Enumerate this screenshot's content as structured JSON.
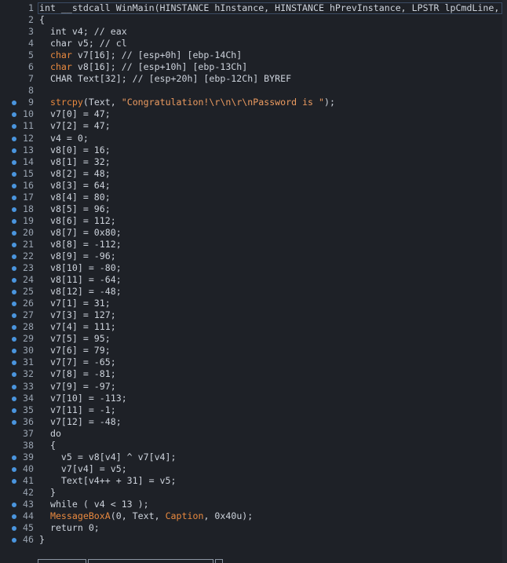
{
  "colors": {
    "background": "#1e2127",
    "text": "#cdd3dc",
    "line_number": "#9aa4b1",
    "breakpoint": "#4a95de",
    "function": "#e8893f",
    "string": "#ec9b60"
  },
  "lines": [
    {
      "num": "1",
      "bp": false,
      "tokens": [
        {
          "t": "int __stdcall WinMain(HINSTANCE hInstance, HINSTANCE hPrevInstance, LPSTR lpCmdLine,",
          "c": "plain"
        }
      ]
    },
    {
      "num": "2",
      "bp": false,
      "tokens": [
        {
          "t": "{",
          "c": "plain"
        }
      ]
    },
    {
      "num": "3",
      "bp": false,
      "tokens": [
        {
          "t": "  int v4; // eax",
          "c": "plain"
        }
      ]
    },
    {
      "num": "4",
      "bp": false,
      "tokens": [
        {
          "t": "  char v5; // cl",
          "c": "plain"
        }
      ]
    },
    {
      "num": "5",
      "bp": false,
      "tokens": [
        {
          "t": "  ",
          "c": "plain"
        },
        {
          "t": "char",
          "c": "red"
        },
        {
          "t": " v7[16]; // [esp+0h] [ebp-14Ch]",
          "c": "plain"
        }
      ]
    },
    {
      "num": "6",
      "bp": false,
      "tokens": [
        {
          "t": "  ",
          "c": "plain"
        },
        {
          "t": "char",
          "c": "red"
        },
        {
          "t": " v8[16]; // [esp+10h] [ebp-13Ch]",
          "c": "plain"
        }
      ]
    },
    {
      "num": "7",
      "bp": false,
      "tokens": [
        {
          "t": "  CHAR Text[32]; // [esp+20h] [ebp-12Ch] BYREF",
          "c": "plain"
        }
      ]
    },
    {
      "num": "8",
      "bp": false,
      "tokens": [
        {
          "t": "",
          "c": "plain"
        }
      ]
    },
    {
      "num": "9",
      "bp": true,
      "tokens": [
        {
          "t": "  ",
          "c": "plain"
        },
        {
          "t": "strcpy",
          "c": "fn"
        },
        {
          "t": "(Text, ",
          "c": "plain"
        },
        {
          "t": "\"Congratulation!\\r\\n\\r\\nPassword is \"",
          "c": "str"
        },
        {
          "t": ");",
          "c": "plain"
        }
      ]
    },
    {
      "num": "10",
      "bp": true,
      "tokens": [
        {
          "t": "  v7[0] = 47;",
          "c": "plain"
        }
      ]
    },
    {
      "num": "11",
      "bp": true,
      "tokens": [
        {
          "t": "  v7[2] = 47;",
          "c": "plain"
        }
      ]
    },
    {
      "num": "12",
      "bp": true,
      "tokens": [
        {
          "t": "  v4 = 0;",
          "c": "plain"
        }
      ]
    },
    {
      "num": "13",
      "bp": true,
      "tokens": [
        {
          "t": "  v8[0] = 16;",
          "c": "plain"
        }
      ]
    },
    {
      "num": "14",
      "bp": true,
      "tokens": [
        {
          "t": "  v8[1] = 32;",
          "c": "plain"
        }
      ]
    },
    {
      "num": "15",
      "bp": true,
      "tokens": [
        {
          "t": "  v8[2] = 48;",
          "c": "plain"
        }
      ]
    },
    {
      "num": "16",
      "bp": true,
      "tokens": [
        {
          "t": "  v8[3] = 64;",
          "c": "plain"
        }
      ]
    },
    {
      "num": "17",
      "bp": true,
      "tokens": [
        {
          "t": "  v8[4] = 80;",
          "c": "plain"
        }
      ]
    },
    {
      "num": "18",
      "bp": true,
      "tokens": [
        {
          "t": "  v8[5] = 96;",
          "c": "plain"
        }
      ]
    },
    {
      "num": "19",
      "bp": true,
      "tokens": [
        {
          "t": "  v8[6] = 112;",
          "c": "plain"
        }
      ]
    },
    {
      "num": "20",
      "bp": true,
      "tokens": [
        {
          "t": "  v8[7] = 0x80;",
          "c": "plain"
        }
      ]
    },
    {
      "num": "21",
      "bp": true,
      "tokens": [
        {
          "t": "  v8[8] = -112;",
          "c": "plain"
        }
      ]
    },
    {
      "num": "22",
      "bp": true,
      "tokens": [
        {
          "t": "  v8[9] = -96;",
          "c": "plain"
        }
      ]
    },
    {
      "num": "23",
      "bp": true,
      "tokens": [
        {
          "t": "  v8[10] = -80;",
          "c": "plain"
        }
      ]
    },
    {
      "num": "24",
      "bp": true,
      "tokens": [
        {
          "t": "  v8[11] = -64;",
          "c": "plain"
        }
      ]
    },
    {
      "num": "25",
      "bp": true,
      "tokens": [
        {
          "t": "  v8[12] = -48;",
          "c": "plain"
        }
      ]
    },
    {
      "num": "26",
      "bp": true,
      "tokens": [
        {
          "t": "  v7[1] = 31;",
          "c": "plain"
        }
      ]
    },
    {
      "num": "27",
      "bp": true,
      "tokens": [
        {
          "t": "  v7[3] = 127;",
          "c": "plain"
        }
      ]
    },
    {
      "num": "28",
      "bp": true,
      "tokens": [
        {
          "t": "  v7[4] = 111;",
          "c": "plain"
        }
      ]
    },
    {
      "num": "29",
      "bp": true,
      "tokens": [
        {
          "t": "  v7[5] = 95;",
          "c": "plain"
        }
      ]
    },
    {
      "num": "30",
      "bp": true,
      "tokens": [
        {
          "t": "  v7[6] = 79;",
          "c": "plain"
        }
      ]
    },
    {
      "num": "31",
      "bp": true,
      "tokens": [
        {
          "t": "  v7[7] = -65;",
          "c": "plain"
        }
      ]
    },
    {
      "num": "32",
      "bp": true,
      "tokens": [
        {
          "t": "  v7[8] = -81;",
          "c": "plain"
        }
      ]
    },
    {
      "num": "33",
      "bp": true,
      "tokens": [
        {
          "t": "  v7[9] = -97;",
          "c": "plain"
        }
      ]
    },
    {
      "num": "34",
      "bp": true,
      "tokens": [
        {
          "t": "  v7[10] = -113;",
          "c": "plain"
        }
      ]
    },
    {
      "num": "35",
      "bp": true,
      "tokens": [
        {
          "t": "  v7[11] = -1;",
          "c": "plain"
        }
      ]
    },
    {
      "num": "36",
      "bp": true,
      "tokens": [
        {
          "t": "  v7[12] = -48;",
          "c": "plain"
        }
      ]
    },
    {
      "num": "37",
      "bp": false,
      "tokens": [
        {
          "t": "  do",
          "c": "plain"
        }
      ]
    },
    {
      "num": "38",
      "bp": false,
      "tokens": [
        {
          "t": "  {",
          "c": "plain"
        }
      ]
    },
    {
      "num": "39",
      "bp": true,
      "tokens": [
        {
          "t": "    v5 = v8[v4] ^ v7[v4];",
          "c": "plain"
        }
      ]
    },
    {
      "num": "40",
      "bp": true,
      "tokens": [
        {
          "t": "    v7[v4] = v5;",
          "c": "plain"
        }
      ]
    },
    {
      "num": "41",
      "bp": true,
      "tokens": [
        {
          "t": "    Text[v4++ + 31] = v5;",
          "c": "plain"
        }
      ]
    },
    {
      "num": "42",
      "bp": false,
      "tokens": [
        {
          "t": "  }",
          "c": "plain"
        }
      ]
    },
    {
      "num": "43",
      "bp": true,
      "tokens": [
        {
          "t": "  while ( v4 < 13 );",
          "c": "plain"
        }
      ]
    },
    {
      "num": "44",
      "bp": true,
      "tokens": [
        {
          "t": "  ",
          "c": "plain"
        },
        {
          "t": "MessageBoxA",
          "c": "fn"
        },
        {
          "t": "(0, Text, ",
          "c": "plain"
        },
        {
          "t": "Caption",
          "c": "fn"
        },
        {
          "t": ", 0x40u);",
          "c": "plain"
        }
      ]
    },
    {
      "num": "45",
      "bp": true,
      "tokens": [
        {
          "t": "  return 0;",
          "c": "plain"
        }
      ]
    },
    {
      "num": "46",
      "bp": true,
      "tokens": [
        {
          "t": "}",
          "c": "plain"
        }
      ]
    }
  ]
}
